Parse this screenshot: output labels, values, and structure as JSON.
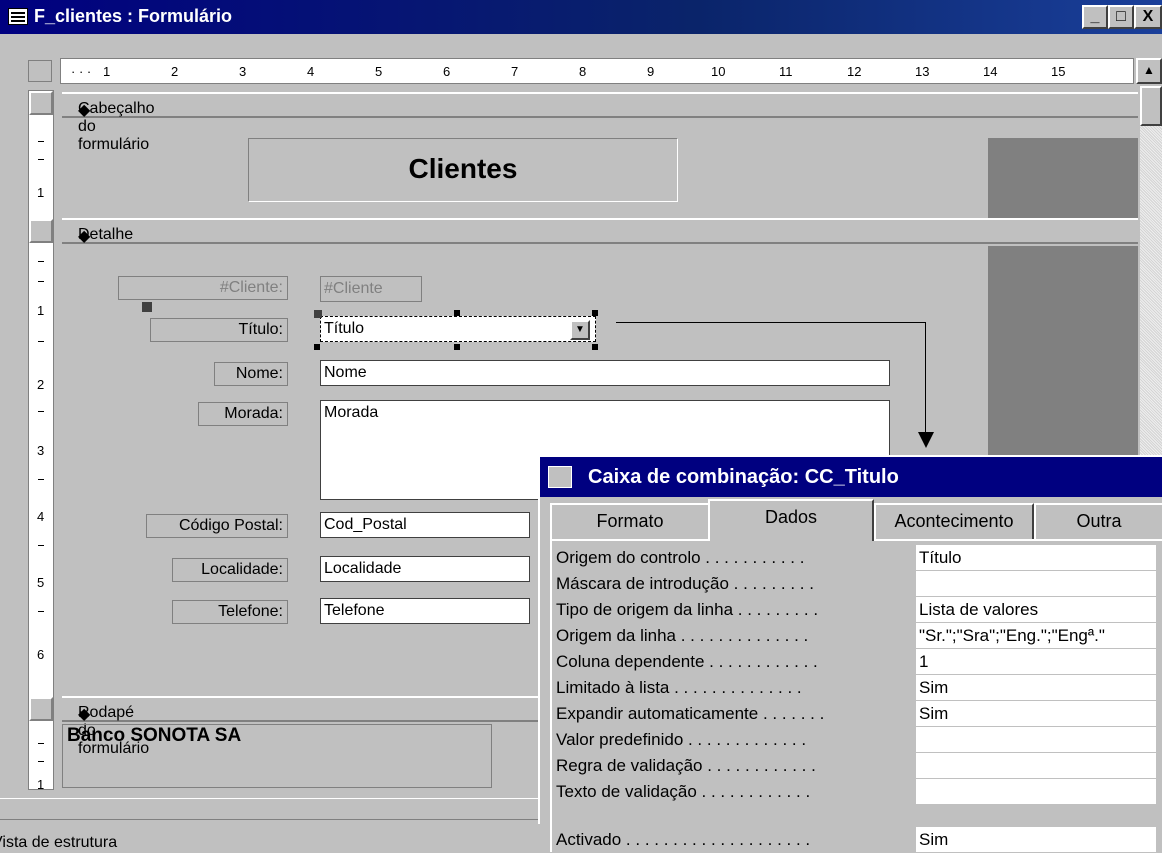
{
  "window": {
    "title": "F_clientes : Formulário",
    "buttons": {
      "minimize": "_",
      "maximize": "□",
      "close": "X"
    }
  },
  "ruler": {
    "horizontal_marks": [
      "1",
      "2",
      "3",
      "4",
      "5",
      "6",
      "7",
      "8",
      "9",
      "10",
      "11",
      "12",
      "13",
      "14",
      "15"
    ],
    "vertical_marks": [
      "1",
      "1",
      "2",
      "3",
      "4",
      "5",
      "6",
      "1"
    ]
  },
  "sections": {
    "header": "Cabeçalho do formulário",
    "detail": "Detalhe",
    "footer": "Rodapé do formulário"
  },
  "header_title": "Clientes",
  "form_fields": [
    {
      "label": "#Cliente:",
      "value": "#Cliente"
    },
    {
      "label": "Título:",
      "value": "Título"
    },
    {
      "label": "Nome:",
      "value": "Nome"
    },
    {
      "label": "Morada:",
      "value": "Morada"
    },
    {
      "label": "Código Postal:",
      "value": "Cod_Postal"
    },
    {
      "label": "Localidade:",
      "value": "Localidade"
    },
    {
      "label": "Telefone:",
      "value": "Telefone"
    }
  ],
  "footer_text": "Banco SONOTA SA",
  "properties": {
    "title": "Caixa de combinação: CC_Titulo",
    "tabs": [
      "Formato",
      "Dados",
      "Acontecimento",
      "Outra"
    ],
    "active_tab": "Dados",
    "rows": [
      {
        "name": "Origem do controlo . . . . . . . . . . .",
        "value": "Título"
      },
      {
        "name": "Máscara de introdução . . . . . . . . .",
        "value": ""
      },
      {
        "name": "Tipo de origem da linha . . . . . . . . .",
        "value": "Lista de valores"
      },
      {
        "name": "Origem da linha . . . . . . . . . . . . . .",
        "value": "\"Sr.\";\"Sra\";\"Eng.\";\"Engª.\""
      },
      {
        "name": "Coluna dependente . . . . . . . . . . . .",
        "value": "1"
      },
      {
        "name": "Limitado à lista . . . . . . . . . . . . . .",
        "value": "Sim"
      },
      {
        "name": "Expandir automaticamente . . . . . . .",
        "value": "Sim"
      },
      {
        "name": "Valor predefinido . . . . . . . . . . . . .",
        "value": ""
      },
      {
        "name": "Regra de validação . . . . . . . . . . . .",
        "value": ""
      },
      {
        "name": "Texto de validação . . . . . . . . . . . .",
        "value": ""
      },
      {
        "name": "Activado . . . . . . . . . . . . . . . . . . . .",
        "value": "Sim"
      }
    ]
  },
  "status_bar": "Vista de estrutura"
}
